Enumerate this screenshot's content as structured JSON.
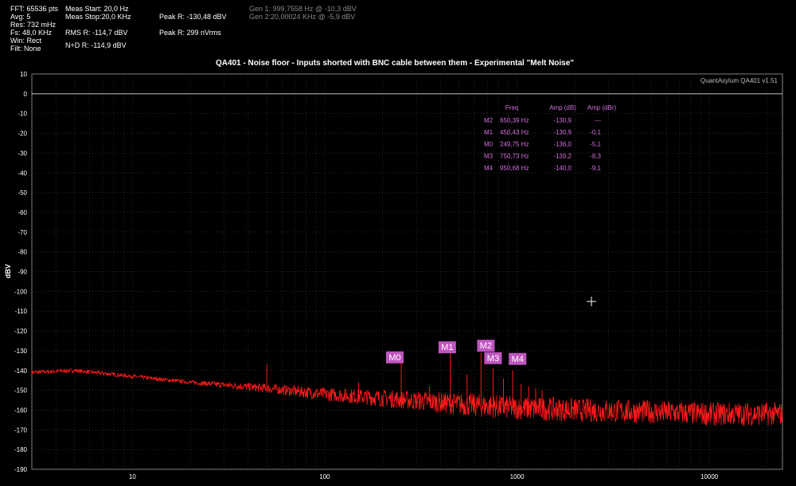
{
  "header": {
    "col1": [
      "FFT: 65536 pts",
      "Avg: 5",
      "Res: 732 mHz",
      "Fs: 48,0 KHz",
      "Win: Rect",
      "Filt: None"
    ],
    "meas_start": "Meas Start: 20,0 Hz",
    "meas_stop": "Meas Stop:20,0 KHz",
    "rms": "RMS R: -114,7 dBV",
    "nd": "N+D R: -114,9 dBV",
    "peak_dbv": "Peak R: -130,48 dBV",
    "peak_nv": "Peak R: 299 nVrms",
    "gen1": "Gen 1: 999,7558 Hz @ -10,3  dBV",
    "gen2": "Gen 2:20,00024 KHz @ -5,9  dBV"
  },
  "chart_data": {
    "type": "line",
    "title": "QA401 - Noise floor - Inputs shorted with BNC cable between them - Experimental \"Melt Noise\"",
    "watermark": "QuantAsylum QA401 v1.51",
    "ylabel": "dBV",
    "xlabel": "",
    "x_scale": "log",
    "xlim": [
      3,
      24000
    ],
    "ylim": [
      -190,
      10
    ],
    "x_ticks": [
      10,
      100,
      1000,
      10000
    ],
    "y_ticks": [
      10,
      0,
      -10,
      -20,
      -30,
      -40,
      -50,
      -60,
      -70,
      -80,
      -90,
      -100,
      -110,
      -120,
      -130,
      -140,
      -150,
      -160,
      -170,
      -180,
      -190
    ],
    "grid": true,
    "colors": {
      "trace": "#ff1a1a",
      "marker": "#c055c0",
      "table_text": "#d070d8",
      "grid": "#444444",
      "reference_line": "#c8c8c8"
    },
    "reference_line_y": 0,
    "noise_floor": [
      [
        3,
        -141
      ],
      [
        5,
        -140
      ],
      [
        10,
        -143
      ],
      [
        20,
        -146
      ],
      [
        50,
        -149
      ],
      [
        100,
        -152
      ],
      [
        200,
        -154
      ],
      [
        500,
        -157
      ],
      [
        1000,
        -159
      ],
      [
        2000,
        -160
      ],
      [
        5000,
        -161
      ],
      [
        10000,
        -162
      ],
      [
        24000,
        -162
      ]
    ],
    "spurs": [
      [
        50,
        -137
      ],
      [
        150,
        -146
      ],
      [
        250,
        -136
      ],
      [
        350,
        -148
      ],
      [
        450,
        -131
      ],
      [
        550,
        -142
      ],
      [
        650,
        -131
      ],
      [
        750,
        -139
      ],
      [
        850,
        -144
      ],
      [
        950,
        -140
      ],
      [
        1050,
        -147
      ],
      [
        1150,
        -148
      ],
      [
        1250,
        -149
      ],
      [
        1350,
        -150
      ]
    ],
    "markers": [
      {
        "label": "M0",
        "x": 249.75,
        "y": -136.0
      },
      {
        "label": "M1",
        "x": 450.43,
        "y": -130.9
      },
      {
        "label": "M2",
        "x": 650.39,
        "y": -130.9
      },
      {
        "label": "M3",
        "x": 750.73,
        "y": -139.2
      },
      {
        "label": "M4",
        "x": 950.68,
        "y": -140.0
      }
    ],
    "marker_table": {
      "headers": [
        "Freq",
        "Amp (dB)",
        "Amp (dBr)"
      ],
      "rows": [
        [
          "M2",
          "650,39 Hz",
          "-130,9",
          "---"
        ],
        [
          "M1",
          "450,43 Hz",
          "-130,9",
          "-0,1"
        ],
        [
          "M0",
          "249,75 Hz",
          "-136,0",
          "-5,1"
        ],
        [
          "M3",
          "750,73 Hz",
          "-139,2",
          "-8,3"
        ],
        [
          "M4",
          "950,68 Hz",
          "-140,0",
          "-9,1"
        ]
      ]
    }
  }
}
